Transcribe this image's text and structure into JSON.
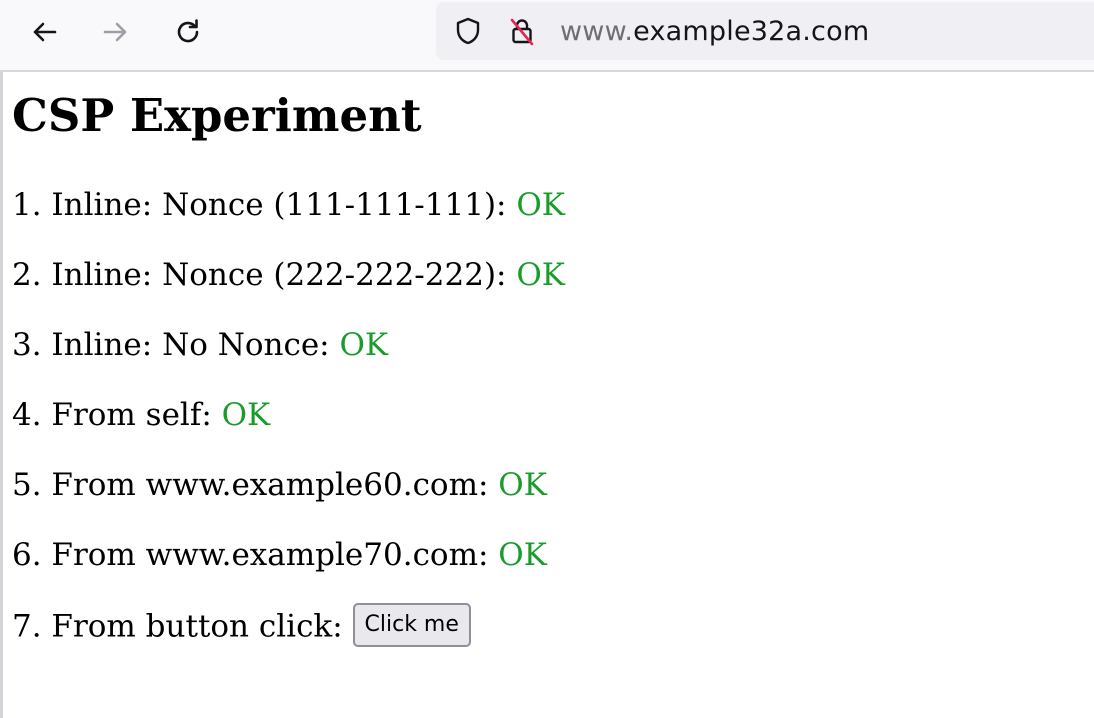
{
  "browser": {
    "url_prefix": "www.",
    "url_domain": "example32a.com",
    "icons": {
      "back": "arrow-left-icon",
      "forward": "arrow-right-icon",
      "reload": "reload-icon",
      "tracking": "shield-icon",
      "security": "insecure-lock-icon"
    }
  },
  "page": {
    "title": "CSP Experiment",
    "rows": [
      {
        "label": "1. Inline: Nonce (111-111-111): ",
        "status": "OK"
      },
      {
        "label": "2. Inline: Nonce (222-222-222): ",
        "status": "OK"
      },
      {
        "label": "3. Inline: No Nonce: ",
        "status": "OK"
      },
      {
        "label": "4. From self: ",
        "status": "OK"
      },
      {
        "label": "5. From www.example60.com: ",
        "status": "OK"
      },
      {
        "label": "6. From www.example70.com: ",
        "status": "OK"
      },
      {
        "label": "7. From button click: ",
        "button": "Click me"
      }
    ]
  },
  "colors": {
    "ok": "#1a9c2b",
    "toolbar_bg": "#f9f9fb",
    "urlbar_bg": "#f0f0f4"
  }
}
